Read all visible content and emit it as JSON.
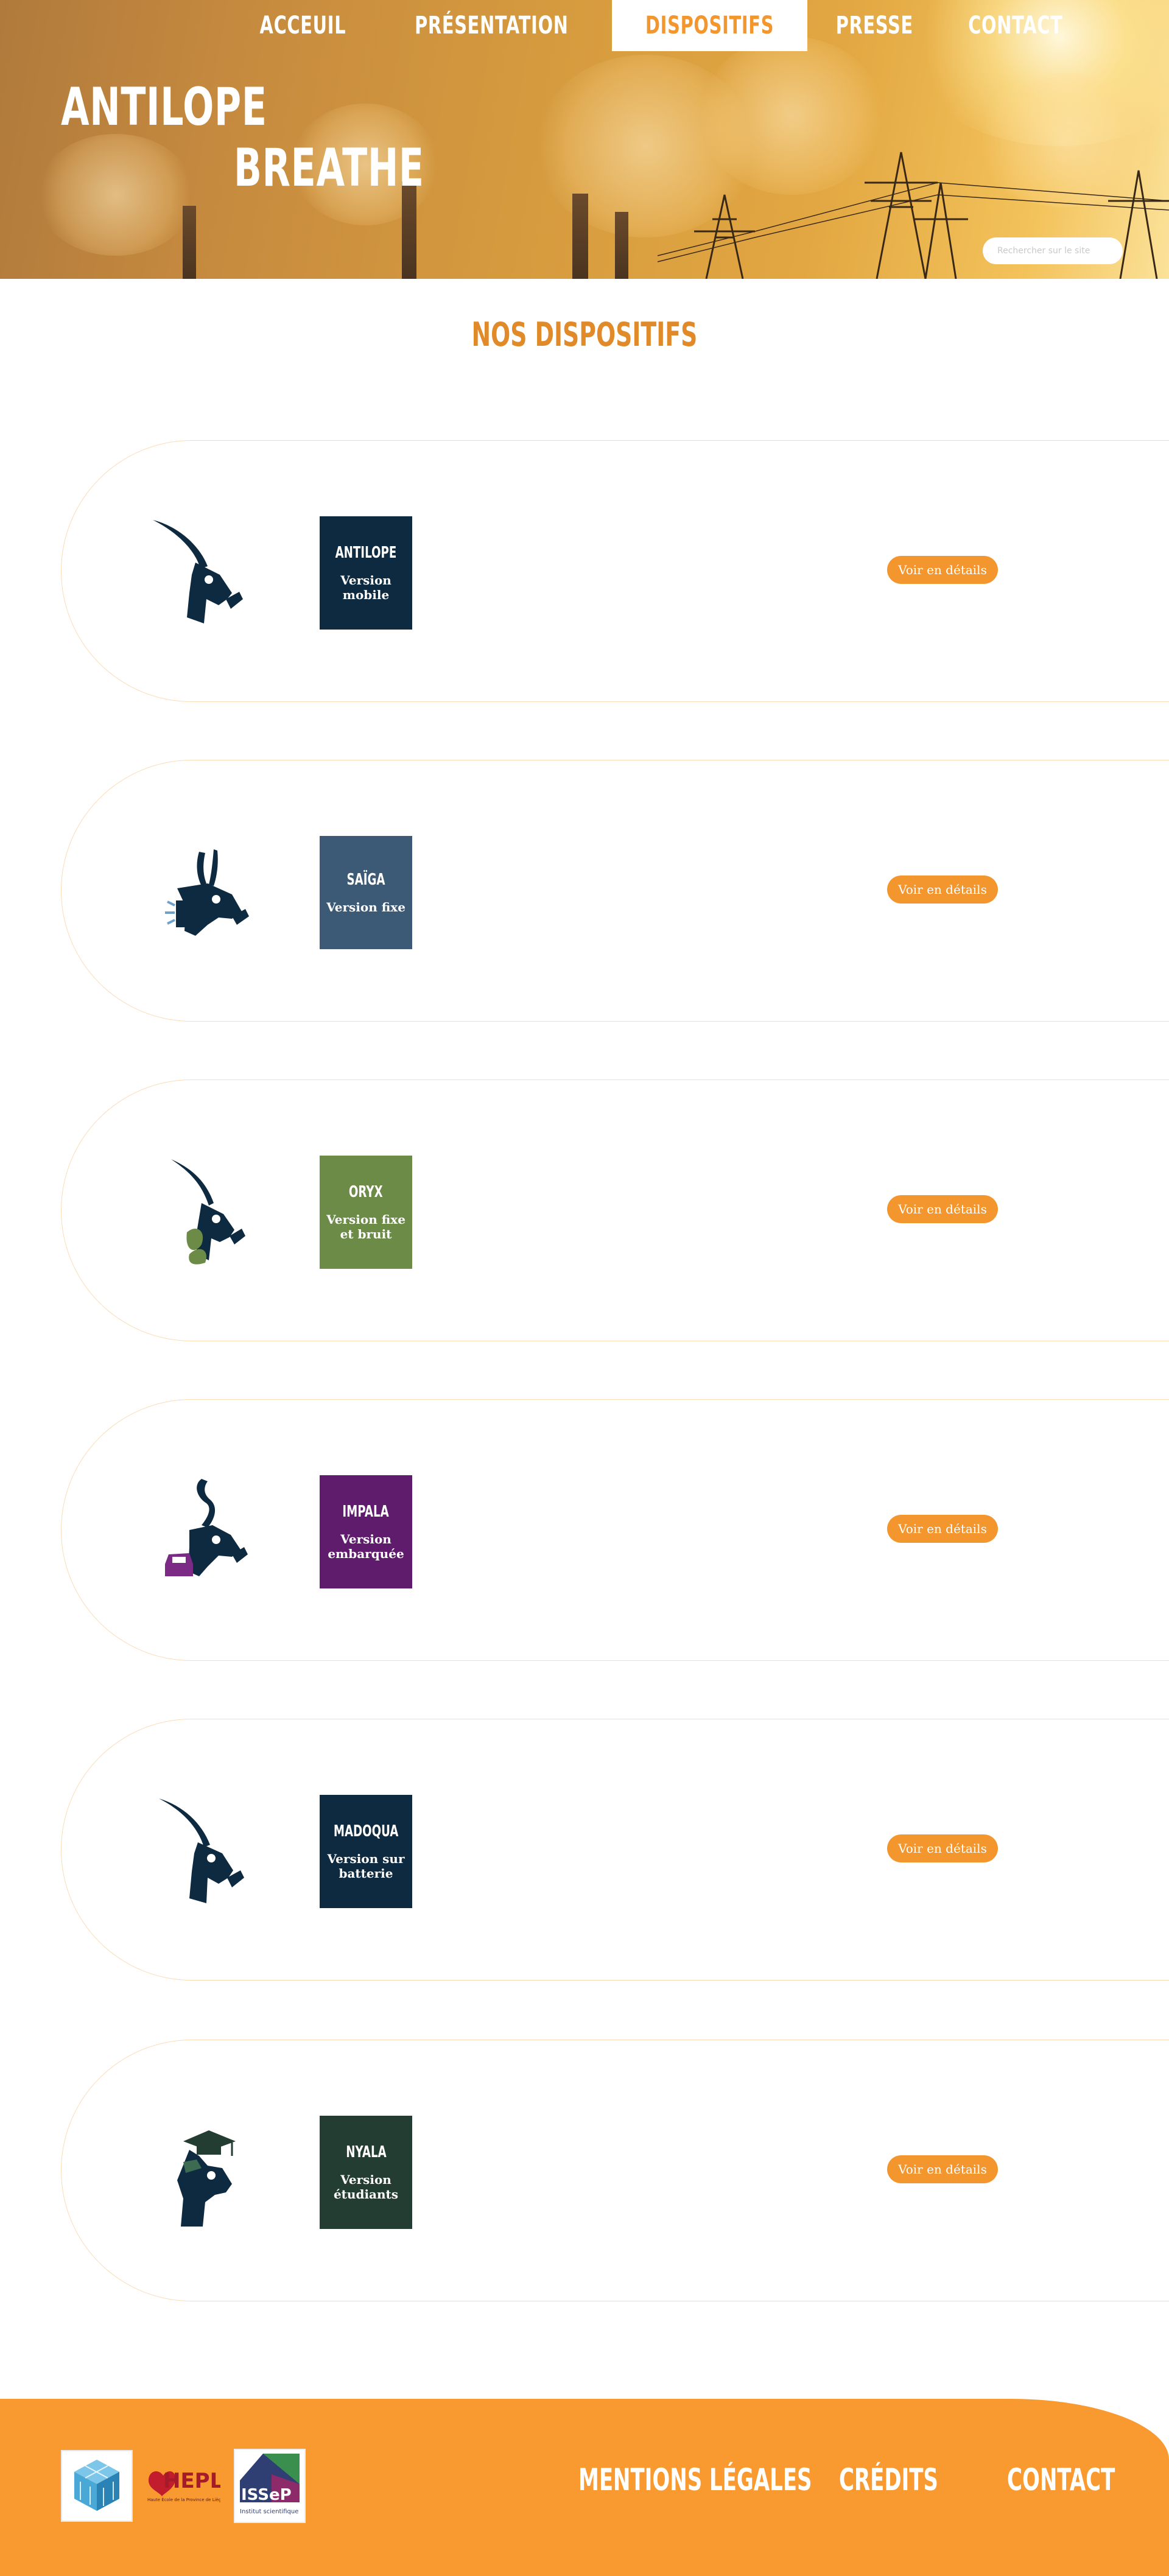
{
  "header": {
    "nav": [
      {
        "label": "ACCEUIL",
        "active": false
      },
      {
        "label": "PRÉSENTATION",
        "active": false
      },
      {
        "label": "DISPOSITIFS",
        "active": true
      },
      {
        "label": "PRESSE",
        "active": false
      },
      {
        "label": "CONTACT",
        "active": false
      }
    ],
    "brand_line1": "ANTILOPE",
    "brand_line2": "BREATHE",
    "search_placeholder": "Rechercher sur le site"
  },
  "main": {
    "title": "NOS DISPOSITIFS",
    "devices": [
      {
        "name": "ANTILOPE",
        "subtitle": "Version mobile",
        "color": "#0d2a40",
        "icon": "antelope-mask-icon",
        "button": "Voir en détails"
      },
      {
        "name": "SAÏGA",
        "subtitle": "Version fixe",
        "color": "#3c5a76",
        "icon": "saiga-mask-sensor-icon",
        "button": "Voir en détails"
      },
      {
        "name": "ORYX",
        "subtitle": "Version fixe et bruit",
        "color": "#6b8b47",
        "icon": "oryx-leaf-icon",
        "button": "Voir en détails"
      },
      {
        "name": "IMPALA",
        "subtitle": "Version embarquée",
        "color": "#5f1c6c",
        "icon": "impala-car-icon",
        "button": "Voir en détails"
      },
      {
        "name": "MADOQUA",
        "subtitle": "Version sur batterie",
        "color": "#0d2a40",
        "icon": "madoqua-mask-icon",
        "button": "Voir en détails"
      },
      {
        "name": "NYALA",
        "subtitle": "Version étudiants",
        "color": "#233d33",
        "icon": "nyala-graduate-icon",
        "button": "Voir en détails"
      }
    ]
  },
  "footer": {
    "logos": [
      "logo-3d-cube",
      "HEPL",
      "ISSeP"
    ],
    "logo2_caption": "Haute École de la Province de Liège",
    "logo3_caption": "Institut scientifique",
    "links": [
      "MENTIONS LÉGALES",
      "CRÉDITS",
      "CONTACT"
    ],
    "accent": "#f99a30"
  },
  "colors": {
    "accent": "#f4962e",
    "title": "#e08a2a",
    "navy": "#0d2a40"
  }
}
